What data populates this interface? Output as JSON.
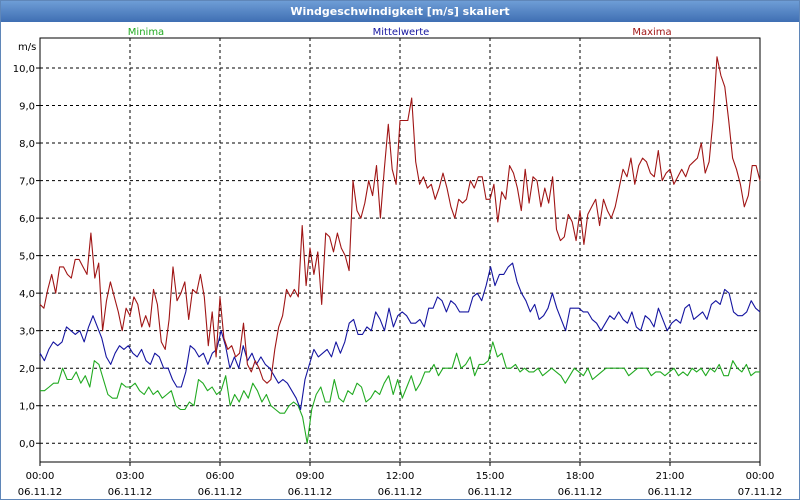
{
  "title": "Windgeschwindigkeit [m/s] skaliert",
  "chart_data": {
    "type": "line",
    "ylabel": "m/s",
    "ylim": [
      -0.5,
      10.8
    ],
    "y_ticks": [
      "0,0",
      "1,0",
      "2,0",
      "3,0",
      "4,0",
      "5,0",
      "6,0",
      "7,0",
      "8,0",
      "9,0",
      "10,0"
    ],
    "y_tick_values": [
      0,
      1,
      2,
      3,
      4,
      5,
      6,
      7,
      8,
      9,
      10
    ],
    "xlim": [
      0,
      24
    ],
    "x_tick_values": [
      0,
      3,
      6,
      9,
      12,
      15,
      18,
      21,
      24
    ],
    "x_tick_times": [
      "00:00",
      "03:00",
      "06:00",
      "09:00",
      "12:00",
      "15:00",
      "18:00",
      "21:00",
      "00:00"
    ],
    "x_tick_dates": [
      "06.11.12",
      "06.11.12",
      "06.11.12",
      "06.11.12",
      "06.11.12",
      "06.11.12",
      "06.11.12",
      "06.11.12",
      "07.11.12"
    ],
    "grid": true,
    "series": [
      {
        "name": "Minima",
        "color": "#22aa22",
        "values": [
          1.4,
          1.4,
          1.5,
          1.6,
          1.6,
          2.0,
          1.7,
          1.7,
          1.9,
          1.6,
          1.8,
          1.5,
          2.2,
          2.1,
          1.7,
          1.3,
          1.2,
          1.2,
          1.6,
          1.5,
          1.5,
          1.6,
          1.4,
          1.3,
          1.5,
          1.3,
          1.4,
          1.2,
          1.3,
          1.4,
          1.0,
          0.9,
          0.9,
          1.1,
          1.0,
          1.7,
          1.6,
          1.4,
          1.5,
          1.3,
          1.4,
          1.8,
          1.0,
          1.3,
          1.1,
          1.4,
          1.2,
          1.6,
          1.4,
          1.1,
          1.3,
          1.0,
          0.9,
          0.8,
          0.8,
          1.0,
          1.1,
          1.0,
          0.7,
          0.0,
          0.9,
          1.3,
          1.5,
          1.1,
          1.1,
          1.7,
          1.2,
          1.1,
          1.4,
          1.3,
          1.6,
          1.5,
          1.1,
          1.2,
          1.4,
          1.3,
          1.6,
          1.8,
          1.3,
          1.7,
          1.2,
          1.5,
          1.8,
          1.4,
          1.6,
          1.9,
          1.9,
          2.1,
          1.8,
          2.0,
          2.0,
          2.0,
          2.4,
          2.0,
          2.1,
          2.3,
          1.8,
          2.1,
          2.1,
          2.2,
          2.7,
          2.3,
          2.4,
          2.0,
          2.0,
          2.1,
          1.9,
          2.0,
          1.9,
          1.9,
          2.0,
          1.8,
          1.9,
          2.0,
          1.9,
          1.8,
          1.6,
          1.8,
          2.0,
          1.9,
          1.8,
          2.0,
          1.7,
          1.8,
          1.9,
          2.0,
          2.0,
          2.0,
          2.0,
          2.0,
          1.8,
          1.9,
          2.0,
          2.0,
          2.0,
          1.8,
          1.9,
          1.9,
          1.8,
          1.9,
          2.0,
          1.8,
          1.9,
          1.8,
          2.0,
          1.9,
          2.0,
          1.8,
          2.0,
          1.9,
          2.1,
          1.8,
          1.8,
          2.2,
          2.0,
          1.9,
          2.1,
          1.8,
          1.9,
          1.9
        ]
      },
      {
        "name": "Mittelwerte",
        "color": "#1515a0",
        "values": [
          2.4,
          2.2,
          2.5,
          2.7,
          2.6,
          2.7,
          3.1,
          3.0,
          2.9,
          3.0,
          2.7,
          3.1,
          3.4,
          3.1,
          2.8,
          2.3,
          2.1,
          2.4,
          2.6,
          2.5,
          2.6,
          2.4,
          2.3,
          2.5,
          2.2,
          2.1,
          2.4,
          2.3,
          2.0,
          2.0,
          1.7,
          1.5,
          1.5,
          1.9,
          2.6,
          2.5,
          2.3,
          2.4,
          2.1,
          2.4,
          2.5,
          3.0,
          2.6,
          2.0,
          2.3,
          2.0,
          2.6,
          2.2,
          2.4,
          2.1,
          2.3,
          2.1,
          2.0,
          1.8,
          1.6,
          1.7,
          1.6,
          1.4,
          1.2,
          0.9,
          1.7,
          2.1,
          2.5,
          2.3,
          2.4,
          2.5,
          2.3,
          2.7,
          2.4,
          2.7,
          3.2,
          3.3,
          2.9,
          2.9,
          3.1,
          3.0,
          3.5,
          3.3,
          3.0,
          3.6,
          3.1,
          3.4,
          3.5,
          3.4,
          3.2,
          3.2,
          3.3,
          3.1,
          3.6,
          3.6,
          3.9,
          3.8,
          3.5,
          3.8,
          3.7,
          3.5,
          3.5,
          3.5,
          3.9,
          4.0,
          3.8,
          4.2,
          4.7,
          4.2,
          4.5,
          4.5,
          4.7,
          4.8,
          4.3,
          4.0,
          3.8,
          3.5,
          3.7,
          3.3,
          3.4,
          3.6,
          4.0,
          3.6,
          3.3,
          3.0,
          3.6,
          3.6,
          3.6,
          3.5,
          3.5,
          3.3,
          3.2,
          3.0,
          3.2,
          3.4,
          3.3,
          3.5,
          3.3,
          3.2,
          3.5,
          3.1,
          3.0,
          3.4,
          3.3,
          3.1,
          3.6,
          3.3,
          3.0,
          3.2,
          3.3,
          3.2,
          3.6,
          3.7,
          3.3,
          3.4,
          3.5,
          3.3,
          3.7,
          3.8,
          3.7,
          4.1,
          4.0,
          3.5,
          3.4,
          3.4,
          3.5,
          3.8,
          3.6,
          3.5
        ]
      },
      {
        "name": "Maxima",
        "color": "#a01515",
        "values": [
          3.7,
          3.6,
          4.1,
          4.5,
          4.0,
          4.7,
          4.7,
          4.5,
          4.4,
          4.9,
          4.9,
          4.7,
          4.5,
          5.6,
          4.4,
          4.8,
          3.0,
          3.8,
          4.3,
          3.9,
          3.5,
          3.0,
          3.6,
          3.4,
          3.9,
          3.7,
          3.1,
          3.4,
          3.1,
          4.1,
          3.7,
          2.7,
          2.5,
          3.3,
          4.7,
          3.8,
          4.0,
          4.3,
          3.3,
          4.1,
          4.0,
          4.5,
          3.9,
          2.6,
          3.5,
          2.3,
          3.9,
          2.8,
          2.5,
          2.6,
          2.3,
          2.4,
          3.2,
          2.1,
          1.9,
          2.2,
          2.0,
          1.7,
          1.6,
          1.7,
          2.5,
          3.1,
          3.4,
          4.1,
          3.9,
          4.1,
          3.9,
          5.8,
          4.2,
          5.2,
          4.5,
          5.1,
          3.7,
          5.6,
          5.5,
          5.1,
          5.6,
          5.2,
          5.0,
          4.6,
          7.0,
          6.2,
          6.0,
          6.4,
          7.0,
          6.6,
          7.4,
          6.0,
          7.3,
          8.5,
          7.3,
          6.9,
          8.6,
          8.6,
          8.6,
          9.2,
          7.5,
          6.9,
          7.1,
          6.8,
          6.9,
          6.5,
          6.8,
          7.2,
          6.8,
          6.3,
          6.0,
          6.5,
          6.4,
          6.5,
          7.0,
          6.8,
          7.1,
          7.1,
          6.5,
          6.5,
          6.9,
          5.9,
          6.7,
          6.5,
          7.4,
          7.2,
          6.8,
          6.2,
          7.3,
          6.4,
          7.1,
          7.0,
          6.3,
          6.8,
          6.4,
          7.1,
          5.7,
          5.4,
          5.5,
          6.1,
          5.9,
          5.4,
          6.2,
          5.3,
          6.1,
          6.3,
          6.5,
          5.8,
          6.5,
          6.2,
          6.0,
          6.3,
          6.8,
          7.3,
          7.1,
          7.6,
          6.9,
          7.4,
          7.6,
          7.5,
          7.2,
          7.1,
          7.8,
          7.0,
          7.2,
          7.3,
          6.9,
          7.1,
          7.3,
          7.1,
          7.4,
          7.5,
          7.6,
          8.0,
          7.2,
          7.5,
          8.6,
          10.3,
          9.8,
          9.5,
          8.6,
          7.6,
          7.3,
          6.9,
          6.3,
          6.6,
          7.4,
          7.4,
          7.0
        ]
      }
    ]
  }
}
